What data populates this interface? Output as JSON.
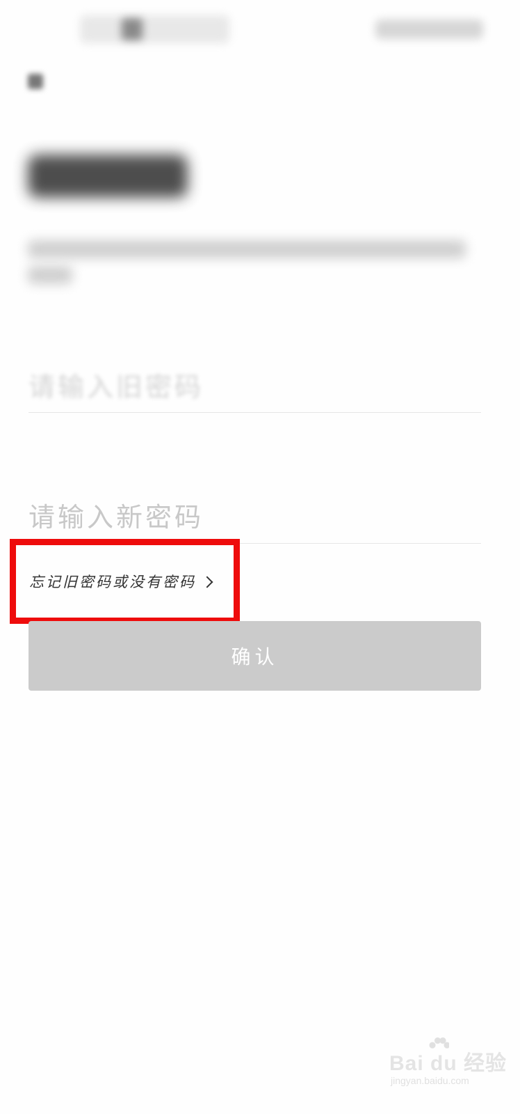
{
  "form": {
    "old_password_placeholder": "请输入旧密码",
    "new_password_placeholder": "请输入新密码",
    "forgot_link_label": "忘记旧密码或没有密码",
    "confirm_label": "确认"
  },
  "icons": {
    "back": "back-arrow-icon",
    "forgot_link_chevron": "chevron-right-icon"
  },
  "colors": {
    "highlight_border": "#ee0c0c",
    "confirm_button_disabled": "#cbcbcb",
    "placeholder_text": "#c8c8c8",
    "field_underline": "#e6e6e6"
  },
  "watermark": {
    "main": "Bai du 经验",
    "sub": "jingyan.baidu.com"
  }
}
